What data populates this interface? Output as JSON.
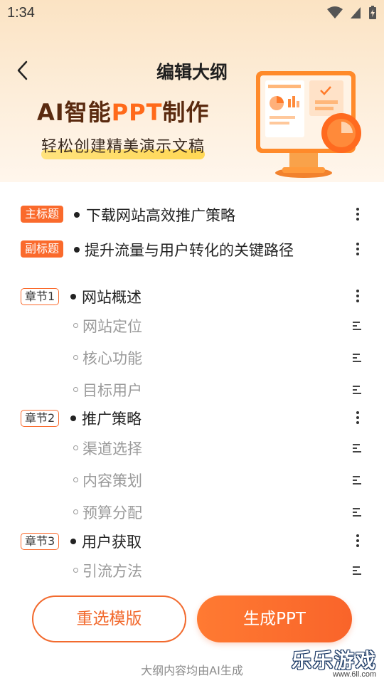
{
  "status_bar": {
    "time": "1:34"
  },
  "header": {
    "title": "编辑大纲",
    "promo_title_ai": "AI智能",
    "promo_title_ppt": "PPT",
    "promo_title_rest": "制作",
    "promo_subtitle": "轻松创建精美演示文稿"
  },
  "outline": {
    "main_title": {
      "badge": "主标题",
      "text": "下载网站高效推广策略"
    },
    "sub_title": {
      "badge": "副标题",
      "text": "提升流量与用户转化的关键路径"
    },
    "chapters": [
      {
        "badge": "章节1",
        "title": "网站概述",
        "items": [
          "网站定位",
          "核心功能",
          "目标用户"
        ]
      },
      {
        "badge": "章节2",
        "title": "推广策略",
        "items": [
          "渠道选择",
          "内容策划",
          "预算分配"
        ]
      },
      {
        "badge": "章节3",
        "title": "用户获取",
        "items": [
          "引流方法"
        ]
      }
    ]
  },
  "actions": {
    "reselect_label": "重选模版",
    "generate_label": "生成PPT"
  },
  "footer": {
    "note": "大纲内容均由AI生成"
  },
  "watermark": {
    "text": "乐乐游戏",
    "url": "www.6ll.com"
  },
  "colors": {
    "accent": "#fa6a2c",
    "dark_brown": "#5a2a0f"
  }
}
